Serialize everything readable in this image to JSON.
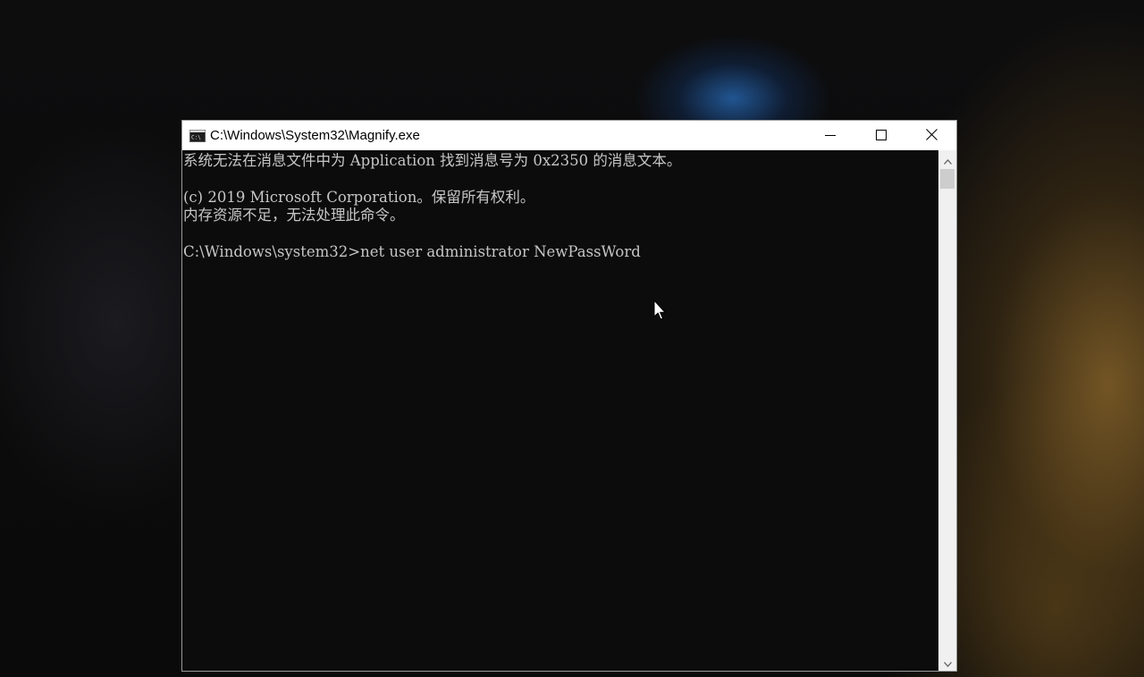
{
  "window": {
    "title": "C:\\Windows\\System32\\Magnify.exe",
    "icon": "console-icon"
  },
  "controls": {
    "minimize_icon": "minimize-icon",
    "maximize_icon": "maximize-icon",
    "close_icon": "close-icon"
  },
  "console": {
    "lines": [
      "系统无法在消息文件中为 Application 找到消息号为 0x2350 的消息文本。",
      "(c) 2019 Microsoft Corporation。保留所有权利。",
      "内存资源不足，无法处理此命令。",
      "C:\\Windows\\system32>net user administrator NewPassWord"
    ]
  },
  "colors": {
    "console_bg": "#0c0c0c",
    "console_text": "#c6c6c6",
    "titlebar_bg": "#ffffff"
  }
}
